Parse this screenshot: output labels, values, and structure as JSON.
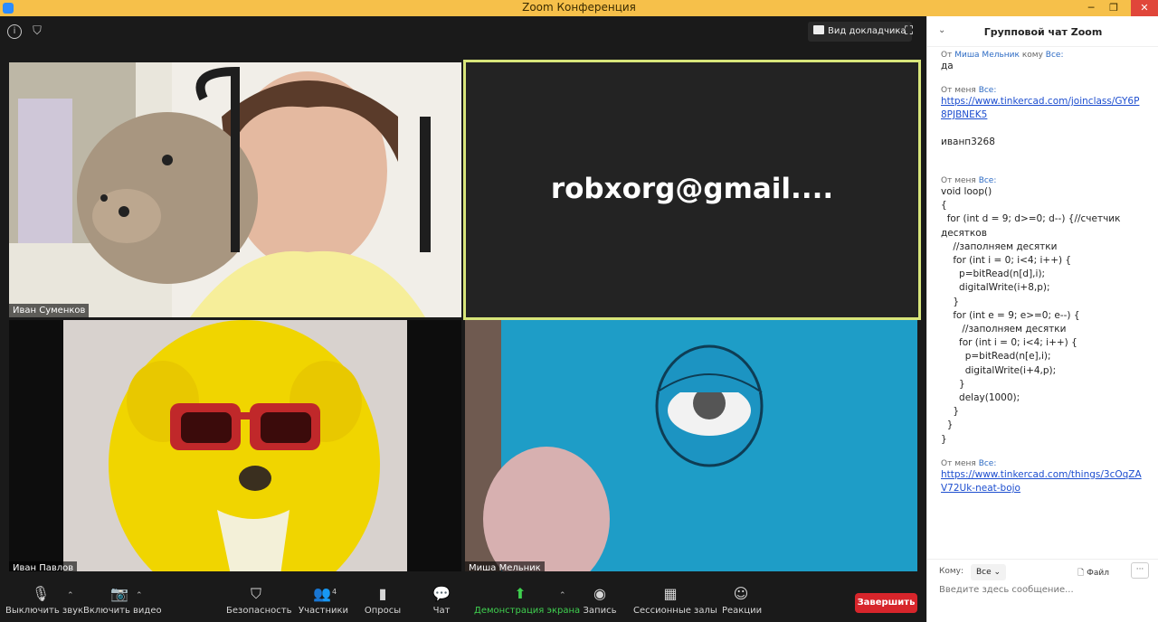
{
  "window": {
    "title": "Zoom Конференция"
  },
  "stage": {
    "view_label": "Вид докладчика"
  },
  "participants": [
    {
      "name": "Иван Суменков"
    },
    {
      "name": "robxorg@gmail...."
    },
    {
      "name": "Иван Павлов"
    },
    {
      "name": "Миша Мельник"
    }
  ],
  "toolbar": {
    "mute": "Выключить звук",
    "video": "Включить видео",
    "security": "Безопасность",
    "participants": "Участники",
    "participants_count": "4",
    "polls": "Опросы",
    "chat": "Чат",
    "share": "Демонстрация экрана",
    "record": "Запись",
    "breakout": "Сессионные залы",
    "reactions": "Реакции",
    "end": "Завершить"
  },
  "chat": {
    "title": "Групповой чат Zoom",
    "messages": [
      {
        "from_prefix": "От",
        "from": "Миша Мельник",
        "to_prefix": "кому",
        "to": "Все:",
        "text": "да"
      },
      {
        "from_prefix": "От меня",
        "from": "",
        "to_prefix": "",
        "to": "Все:",
        "link": "https://www.tinkercad.com/joinclass/GY6P8PJBNEK5",
        "text": "иванп3268"
      },
      {
        "from_prefix": "От меня",
        "from": "",
        "to_prefix": "",
        "to": "Все:",
        "text": "void loop()\n{\n  for (int d = 9; d>=0; d--) {//счетчик десятков\n    //заполняем десятки\n    for (int i = 0; i<4; i++) {\n      p=bitRead(n[d],i);\n      digitalWrite(i+8,p);\n    }\n    for (int e = 9; e>=0; e--) {\n       //заполняем десятки\n      for (int i = 0; i<4; i++) {\n        p=bitRead(n[e],i);\n        digitalWrite(i+4,p);\n      }\n      delay(1000);\n    }\n  }\n}"
      },
      {
        "from_prefix": "От меня",
        "from": "",
        "to_prefix": "",
        "to": "Все:",
        "link": "https://www.tinkercad.com/things/3cOqZAV72Uk-neat-bojo"
      }
    ],
    "to_label": "Кому:",
    "to_value": "Все",
    "file_label": "Файл",
    "more_label": "···",
    "input_placeholder": "Введите здесь сообщение..."
  }
}
